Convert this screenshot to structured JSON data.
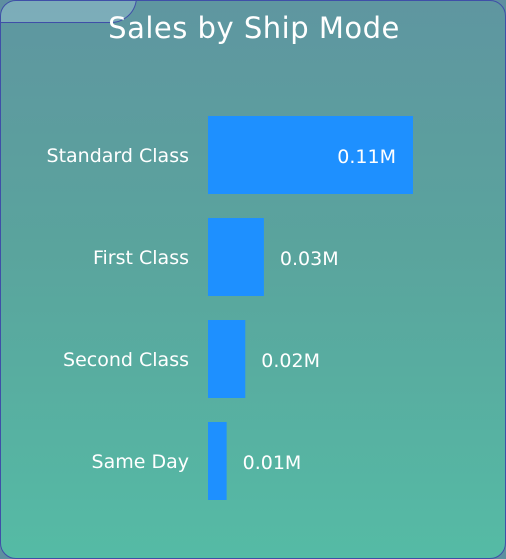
{
  "chart_data": {
    "type": "bar",
    "orientation": "horizontal",
    "title": "Sales by Ship Mode",
    "categories": [
      "Standard Class",
      "First Class",
      "Second Class",
      "Same Day"
    ],
    "values": [
      0.11,
      0.03,
      0.02,
      0.01
    ],
    "data_labels": [
      "0.11M",
      "0.03M",
      "0.02M",
      "0.01M"
    ],
    "unit": "M",
    "xlim": [
      0,
      0.11
    ],
    "grid": false,
    "bar_color": "#1e90ff"
  }
}
